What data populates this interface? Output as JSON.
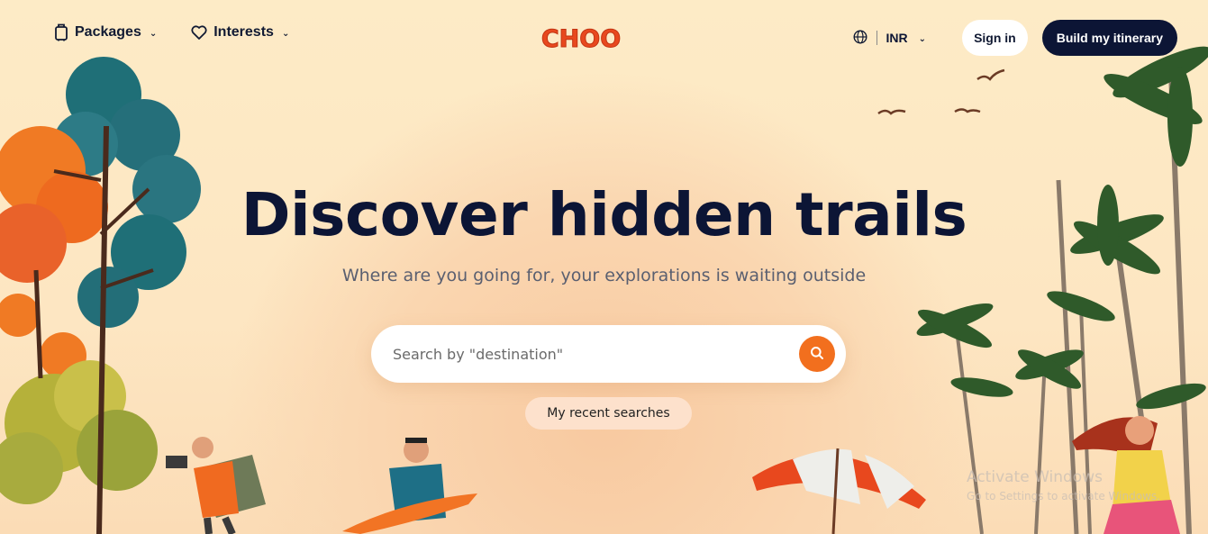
{
  "header": {
    "nav": [
      {
        "label": "Packages",
        "icon": "luggage-icon"
      },
      {
        "label": "Interests",
        "icon": "heart-icon"
      }
    ],
    "logo_text": "CHOO",
    "currency": "INR",
    "signin_label": "Sign in",
    "cta_label": "Build my itinerary"
  },
  "hero": {
    "title": "Discover hidden trails",
    "subtitle": "Where are you going for, your explorations is waiting outside",
    "search_placeholder": "Search by \"destination\"",
    "recent_label": "My recent searches"
  },
  "watermark": {
    "line1": "Activate Windows",
    "line2": "Go to Settings to activate Windows."
  },
  "colors": {
    "background": "#fdebc8",
    "primary_dark": "#0c1535",
    "accent_orange": "#f26f1e",
    "logo_red": "#e8481e"
  }
}
